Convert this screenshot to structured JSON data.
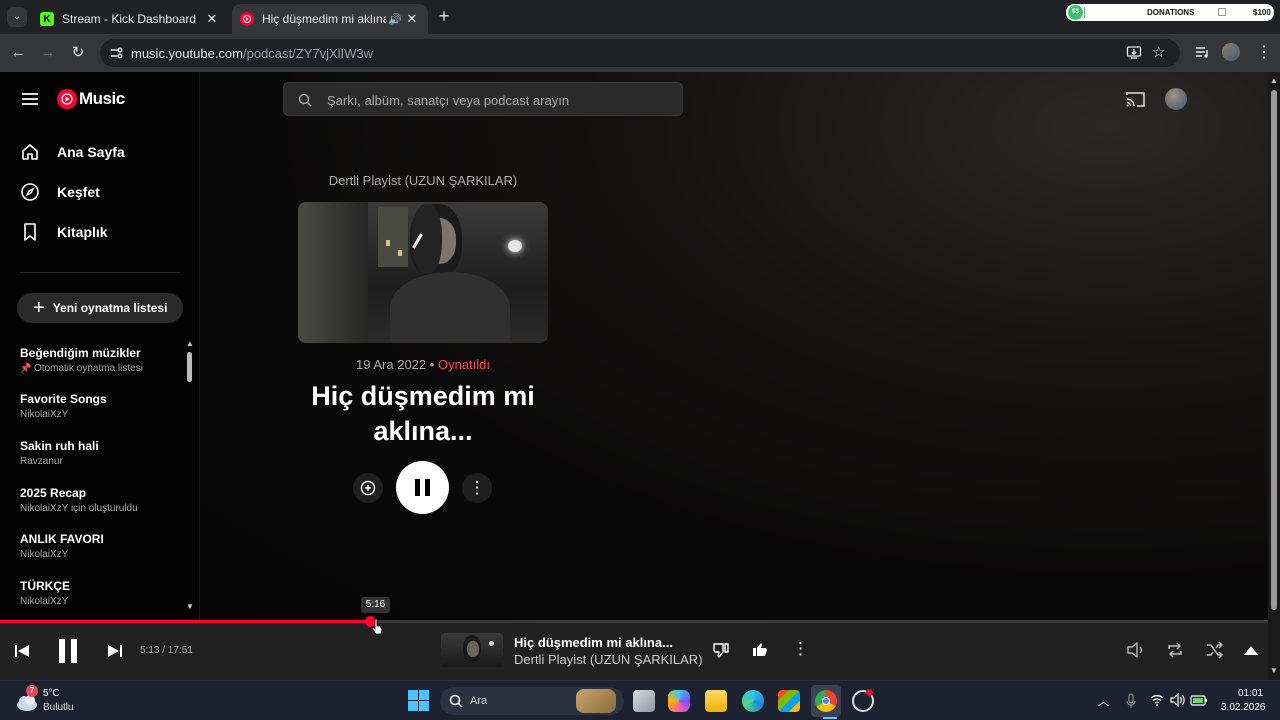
{
  "browser": {
    "tabs": [
      {
        "title": "Stream - Kick Dashboard",
        "favicon": "K"
      },
      {
        "title": "Hiç düşmedim mi aklına... |"
      }
    ],
    "url_host": "music.youtube.com",
    "url_path": "/podcast/ZY7vjXlIW3w",
    "extension_overlay": {
      "label": "DONATIONS",
      "left": "$0",
      "right": "$100"
    }
  },
  "app": {
    "logo_text": "Music",
    "search_placeholder": "Şarkı, albüm, sanatçı veya podcast arayın"
  },
  "sidebar": {
    "nav": [
      {
        "label": "Ana Sayfa",
        "icon": "home-icon"
      },
      {
        "label": "Keşfet",
        "icon": "explore-icon"
      },
      {
        "label": "Kitaplık",
        "icon": "library-icon"
      }
    ],
    "new_playlist_label": "Yeni oynatma listesi",
    "playlists": [
      {
        "title": "Beğendiğim müzikler",
        "subtitle": "Otomatik oynatma listesi",
        "pinned": true
      },
      {
        "title": "Favorite Songs",
        "subtitle": "NikolaiXzY"
      },
      {
        "title": "Sakin ruh hali",
        "subtitle": "Ravzanur"
      },
      {
        "title": "2025 Recap",
        "subtitle": "NikolaiXzY için oluşturuldu"
      },
      {
        "title": "ANLIK FAVORI",
        "subtitle": "NikolaiXzY"
      },
      {
        "title": "TÜRKÇE",
        "subtitle": "NikolaiXzY"
      }
    ]
  },
  "episode": {
    "podcast_name": "Dertli Playist (UZUN ŞARKILAR)",
    "date": "19 Ara 2022",
    "separator": "•",
    "status": "Oynatıldı",
    "title_line1": "Hiç düşmedim mi",
    "title_line2": "aklına..."
  },
  "player": {
    "time": "5:13 / 17:51",
    "hover_time": "5:16",
    "progress_fraction": 0.292,
    "track_title": "Hiç düşmedim mi aklına...",
    "track_artist": "Dertli Playist (UZUN ŞARKILAR)"
  },
  "taskbar": {
    "weather_temp": "5°C",
    "weather_desc": "Bulutlu",
    "weather_badge": "7",
    "search_label": "Ara",
    "clock_time": "01:01",
    "clock_date": "3.02.2026"
  },
  "colors": {
    "accent": "#ff0033",
    "background": "#030303",
    "player_bg": "#212121"
  }
}
